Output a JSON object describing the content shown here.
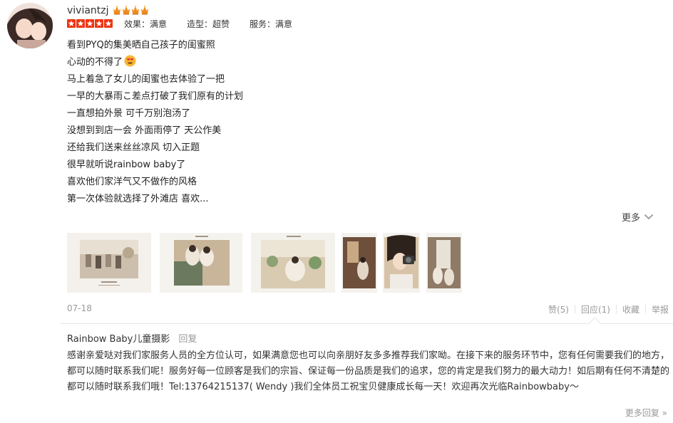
{
  "review": {
    "username": "viviantzj",
    "member_level_icon": "crown-icon",
    "rating_stars": 5,
    "scores": [
      {
        "label": "效果：满意"
      },
      {
        "label": "造型：超赞"
      },
      {
        "label": "服务：满意"
      }
    ],
    "lines": [
      "看到PYQ的集美晒自己孩子的闺蜜照",
      "心动的不得了",
      "马上着急了女儿的闺蜜也去体验了一把",
      "一早的大暴雨こ差点打破了我们原有的计划",
      "一直想拍外景 可千万别泡汤了",
      "没想到到店一会 外面雨停了 天公作美",
      "还给我们送来丝丝凉风 切入正题",
      "很早就听说rainbow baby了",
      "喜欢他们家洋气又不做作的风格",
      "第一次体验就选择了外滩店 喜欢..."
    ],
    "emoji_after_line_2": "heart-eyes-icon",
    "more_label": "更多",
    "date": "07-18",
    "actions": {
      "like": "赞(5)",
      "reply": "回应(1)",
      "favorite": "收藏",
      "report": "举报"
    }
  },
  "reply": {
    "author": "Rainbow Baby儿童摄影",
    "label": "回复",
    "text": "感谢亲爱哒对我们家服务人员的全方位认可，如果满意您也可以向亲朋好友多多推荐我们家呦。在接下来的服务环节中，您有任何需要我们的地方，都可以随时联系我们呢！服务好每一位顾客是我们的宗旨、保证每一份品质是我们的追求，您的肯定是我们努力的最大动力！如后期有任何不清楚的都可以随时联系我们哦！Tel:13764215137( Wendy )我们全体员工祝宝贝健康成长每一天！欢迎再次光临Rainbowbaby～",
    "more_replies": "更多回复 »"
  },
  "colors": {
    "star_red": "#ee3311",
    "crown_orange": "#f08c1e",
    "muted_text": "#999999",
    "divider": "#e6e6e6"
  }
}
